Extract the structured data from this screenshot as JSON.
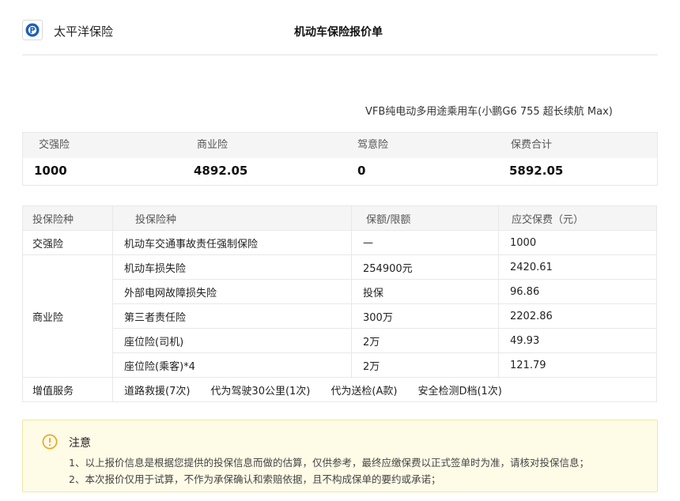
{
  "header": {
    "brand": "太平洋保险",
    "title": "机动车保险报价单",
    "logo_icon": "pacific-insurance-logo-icon",
    "brand_color": "#1f5fb5"
  },
  "vehicle": "VFB纯电动多用途乘用车(小鹏G6 755 超长续航 Max)",
  "summary": {
    "headers": [
      "交强险",
      "商业险",
      "驾意险",
      "保费合计"
    ],
    "values": [
      "1000",
      "4892.05",
      "0",
      "5892.05"
    ]
  },
  "detail": {
    "headers": [
      "投保险种",
      "投保险种",
      "保额/限额",
      "应交保费（元）"
    ],
    "compulsory": {
      "category": "交强险",
      "name": "机动车交通事故责任强制保险",
      "limit": "—",
      "premium": "1000"
    },
    "commercial": {
      "category": "商业险",
      "rows": [
        {
          "name": "机动车损失险",
          "limit": "254900元",
          "premium": "2420.61"
        },
        {
          "name": "外部电网故障损失险",
          "limit": "投保",
          "premium": "96.86"
        },
        {
          "name": "第三者责任险",
          "limit": "300万",
          "premium": "2202.86"
        },
        {
          "name": "座位险(司机)",
          "limit": "2万",
          "premium": "49.93"
        },
        {
          "name": "座位险(乘客)*4",
          "limit": "2万",
          "premium": "121.79"
        }
      ]
    },
    "value_added": {
      "category": "增值服务",
      "items": [
        "道路救援(7次)",
        "代为驾驶30公里(1次)",
        "代为送检(A款)",
        "安全检测D档(1次)"
      ]
    }
  },
  "notice": {
    "icon": "warning-circle-icon",
    "icon_color": "#f0a020",
    "title": "注意",
    "lines": [
      "1、以上报价信息是根据您提供的投保信息而做的估算，仅供参考，最终应缴保费以正式签单时为准，请核对投保信息；",
      "2、本次报价仅用于试算，不作为承保确认和索赔依据，且不构成保单的要约或承诺；"
    ]
  }
}
